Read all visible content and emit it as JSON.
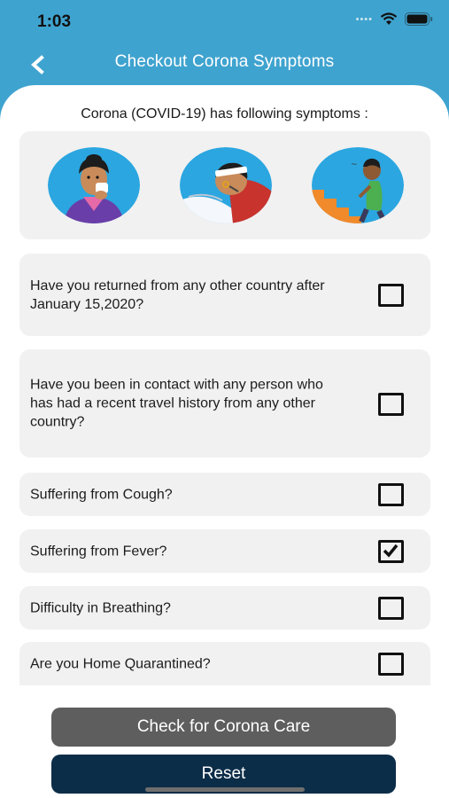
{
  "status_bar": {
    "time": "1:03"
  },
  "nav": {
    "title": "Checkout Corona Symptoms"
  },
  "intro_text": "Corona (COVID-19) has following symptoms :",
  "illustrations": [
    {
      "name": "cough-illustration"
    },
    {
      "name": "fever-illustration"
    },
    {
      "name": "breathing-difficulty-illustration"
    }
  ],
  "questions": [
    {
      "text": "Have you returned from any other country after January 15,2020?",
      "checked": false
    },
    {
      "text": "Have you been in contact with any person who has had a recent travel history from any other country?",
      "checked": false
    },
    {
      "text": "Suffering from Cough?",
      "checked": false
    },
    {
      "text": "Suffering from Fever?",
      "checked": true
    },
    {
      "text": "Difficulty in Breathing?",
      "checked": false
    },
    {
      "text": "Are you Home Quarantined?",
      "checked": false
    }
  ],
  "buttons": {
    "check_label": "Check for Corona Care",
    "reset_label": "Reset"
  },
  "colors": {
    "header": "#3fa3cf",
    "card": "#f1f1f1",
    "check_button": "#5e5e5e",
    "reset_button": "#0c2d48"
  }
}
